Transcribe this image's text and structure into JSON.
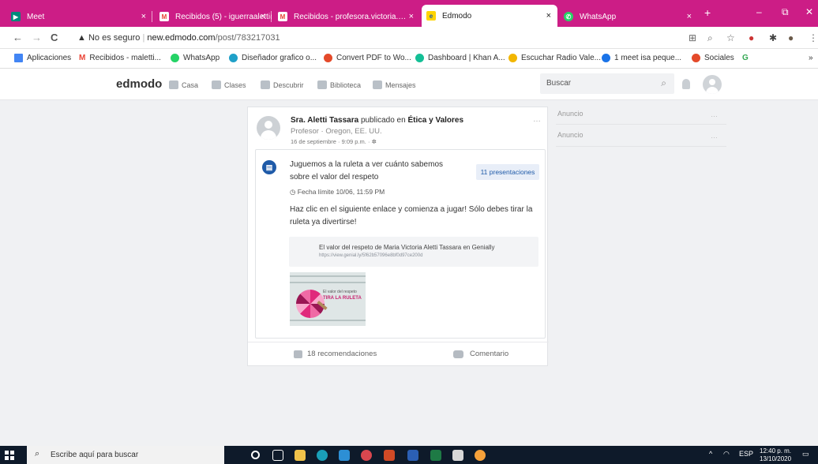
{
  "browser": {
    "tabs": [
      {
        "label": "Meet",
        "icon": "meet-icon",
        "color": "#00897b"
      },
      {
        "label": "Recibidos (5) - iguerraaletti@…",
        "icon": "gmail-icon",
        "color": "#ffffff"
      },
      {
        "label": "Recibidos - profesora.victoria.…",
        "icon": "gmail-icon",
        "color": "#ffffff"
      },
      {
        "label": "Edmodo",
        "icon": "edmodo-icon",
        "color": "#ffd400"
      },
      {
        "label": "WhatsApp",
        "icon": "whatsapp-icon",
        "color": "#25d366"
      }
    ],
    "tab_close": "×",
    "new_tab": "+",
    "window_controls": {
      "minimize": "–",
      "maximize": "⧉",
      "close": "✕"
    },
    "nav": {
      "back": "←",
      "forward": "→",
      "reload": "C"
    },
    "address": {
      "security": "No es seguro",
      "domain": "new.edmodo.com",
      "path": "/post/783217031"
    },
    "bookmarks": [
      {
        "label": "Aplicaciones",
        "color": "#4285f4"
      },
      {
        "label": "Recibidos - maletti...",
        "color": "#ea4335"
      },
      {
        "label": "WhatsApp",
        "color": "#25d366"
      },
      {
        "label": "Diseñador grafico o...",
        "color": "#1fa0c8"
      },
      {
        "label": "Convert PDF to Wo...",
        "color": "#e44a2a"
      },
      {
        "label": "Dashboard | Khan A...",
        "color": "#14bf96"
      },
      {
        "label": "Escuchar Radio Vale...",
        "color": "#f2b600"
      },
      {
        "label": "1 meet  isa peque...",
        "color": "#1a73e8"
      },
      {
        "label": "Sociales",
        "color": "#e44a2a"
      },
      {
        "label": "G",
        "color": "#34a853"
      }
    ],
    "bookmarks_more": "»"
  },
  "edmodo": {
    "logo": "edmodo",
    "nav": [
      "Casa",
      "Clases",
      "Descubrir",
      "Biblioteca",
      "Mensajes"
    ],
    "search_placeholder": "Buscar"
  },
  "post": {
    "author": "Sra. Aletti Tassara",
    "published_in": "publicado en",
    "group": "Ética y Valores",
    "role": "Profesor · Oregon, EE. UU.",
    "date": "16 de septiembre · 9:09 p.m. ·",
    "more": "…",
    "assignment": {
      "title": "Juguemos a la ruleta a ver cuánto sabemos sobre el valor del respeto",
      "submissions": "11 presentaciones",
      "due": "Fecha límite 10/06, 11:59 PM",
      "text": "Haz clic en el siguiente enlace y comienza a jugar! Sólo debes tirar la ruleta ya divertirse!",
      "link_title": "El valor del respeto de Maria Victoria Aletti Tassara en Genially",
      "link_url": "https://view.genial.ly/5f62b57096e8bf0d97ce200d",
      "thumb_caption": "El valor del respeto",
      "thumb_title": "TIRA LA RULETA"
    },
    "likes": "18 recomendaciones",
    "comment": "Comentario"
  },
  "ads": [
    {
      "label": "Anuncio",
      "more": "…"
    },
    {
      "label": "Anuncio",
      "more": "…"
    }
  ],
  "taskbar": {
    "search": "Escribe aquí para buscar",
    "lang": "ESP",
    "time": "12:40 p. m.",
    "date": "13/10/2020"
  }
}
